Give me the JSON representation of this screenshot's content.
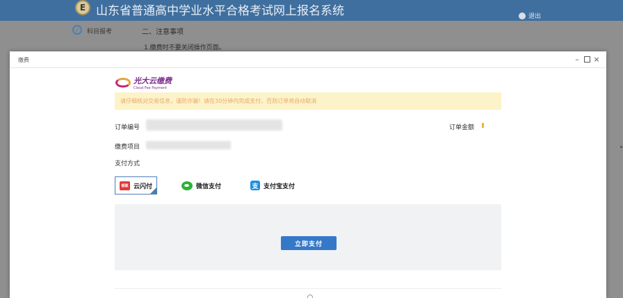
{
  "app": {
    "logo_glyph": "E",
    "title": "山东省普通高中学业水平合格考试网上报名系统",
    "logout_label": "退出"
  },
  "progress": {
    "step_label": "科目报考",
    "step_icon": "check-icon"
  },
  "notice": {
    "title": "二、注意事项",
    "item_1": "1.缴费时不要关闭操作页面。"
  },
  "modal": {
    "title": "缴费",
    "controls": {
      "minimize": "–",
      "close": "×"
    },
    "brand_cn": "光大云缴费",
    "brand_en": "Cloud Fee Payment",
    "warning": "请仔细核对交易信息，谨防诈骗！请在30分钟内完成支付，否则订单将自动取消",
    "order_no_label": "订单编号",
    "order_amount_label": "订单金额",
    "fee_item_label": "缴费项目",
    "pay_method_label": "支付方式",
    "pay_options": [
      {
        "label": "云闪付",
        "icon": "unionpay-icon",
        "icon_text": "银联",
        "selected": true
      },
      {
        "label": "微信支付",
        "icon": "wechat-icon",
        "selected": false
      },
      {
        "label": "支付宝支付",
        "icon": "alipay-icon",
        "icon_text": "支",
        "selected": false
      }
    ],
    "pay_button_label": "立即支付"
  },
  "colors": {
    "header_bg": "#3f6f9e",
    "accent": "#3578c8",
    "warning_bg": "#fdf3c9",
    "warning_text": "#e8a86a",
    "brand": "#7a2a8c"
  }
}
